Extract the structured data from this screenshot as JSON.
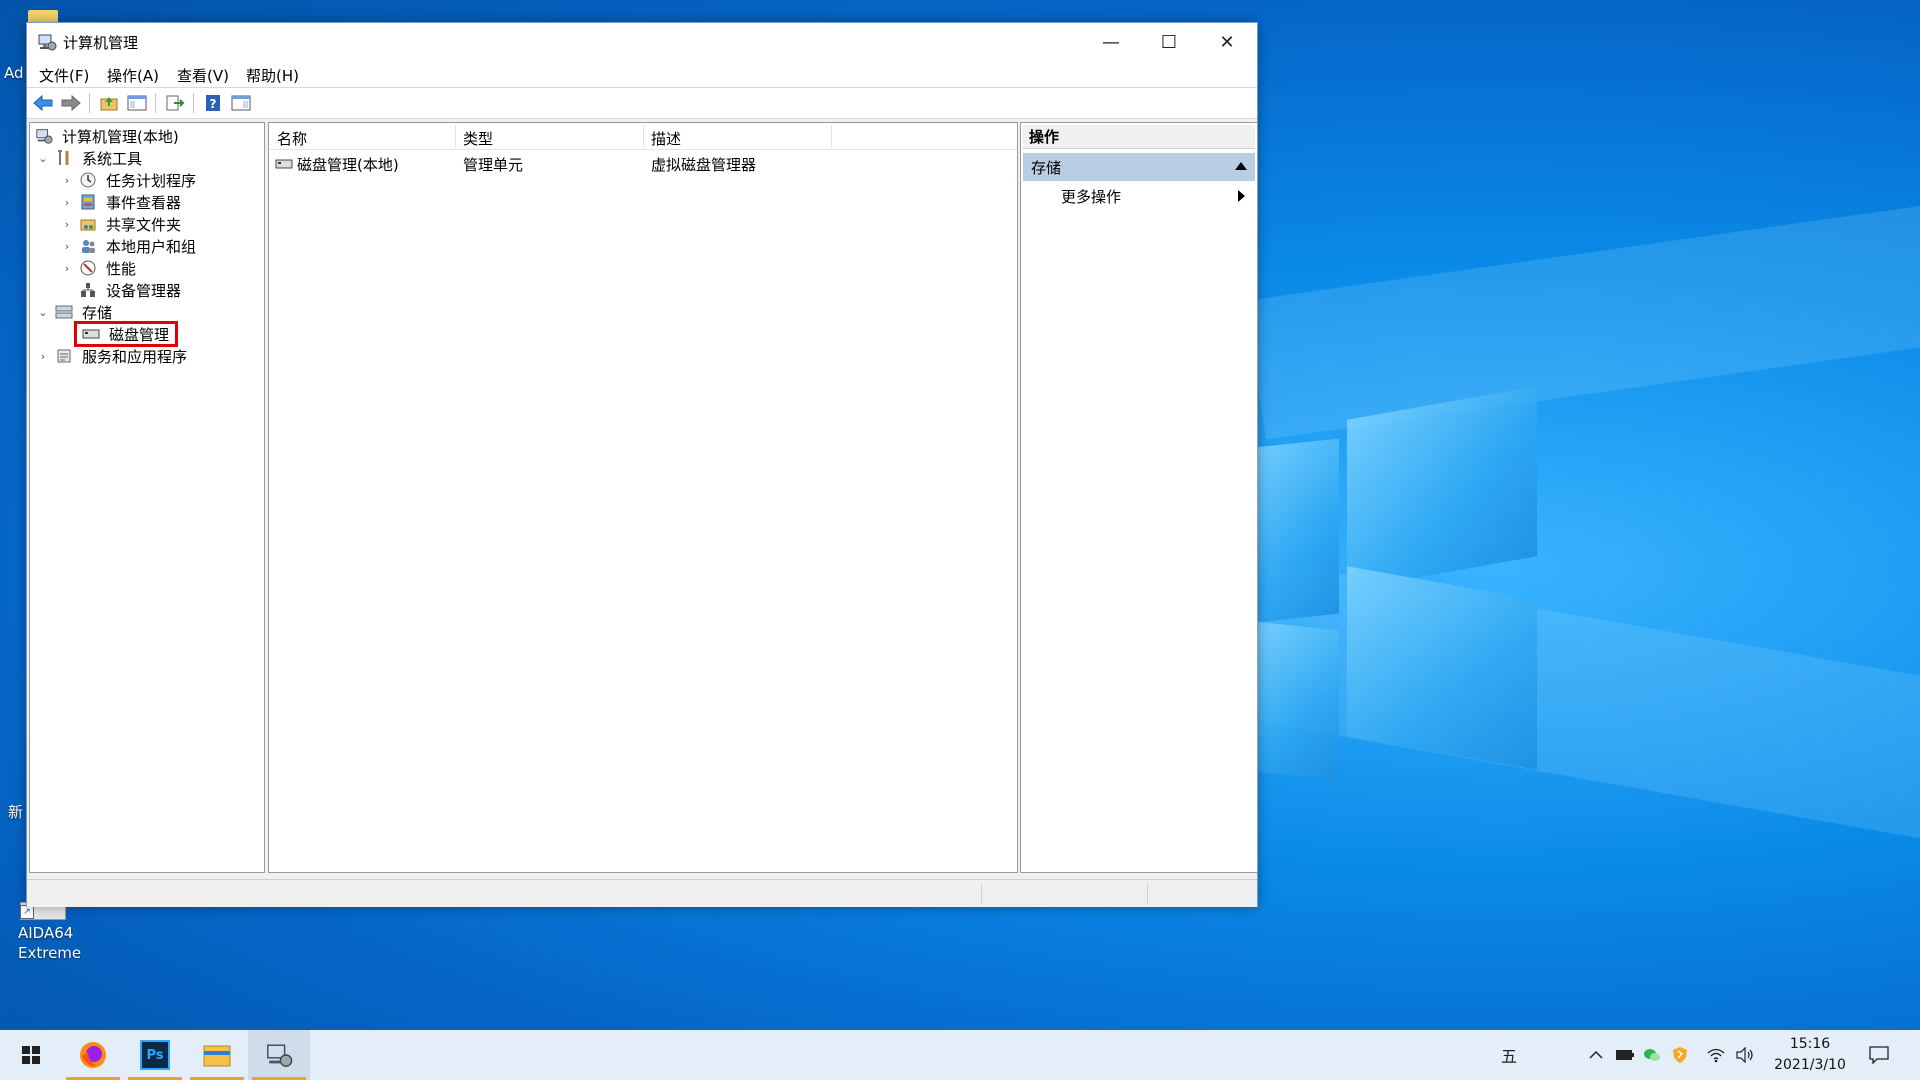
{
  "window": {
    "title": "计算机管理",
    "controls": {
      "minimize": "—",
      "maximize": "☐",
      "close": "✕"
    }
  },
  "menu": [
    "文件(F)",
    "操作(A)",
    "查看(V)",
    "帮助(H)"
  ],
  "tree": {
    "root": "计算机管理(本地)",
    "system_tools": "系统工具",
    "task_scheduler": "任务计划程序",
    "event_viewer": "事件查看器",
    "shared_folders": "共享文件夹",
    "local_users": "本地用户和组",
    "performance": "性能",
    "device_manager": "设备管理器",
    "storage": "存储",
    "disk_management": "磁盘管理",
    "services_apps": "服务和应用程序"
  },
  "list": {
    "headers": [
      "名称",
      "类型",
      "描述"
    ],
    "rows": [
      {
        "name": "磁盘管理(本地)",
        "type": "管理单元",
        "desc": "虚拟磁盘管理器"
      }
    ]
  },
  "actions": {
    "title": "操作",
    "section": "存储",
    "more": "更多操作"
  },
  "desktop": {
    "edge_text_top": "Ad",
    "edge_text_mid": "新",
    "icon_label_line1": "AIDA64",
    "icon_label_line2": "Extreme"
  },
  "taskbar": {
    "ime": "五",
    "time": "15:16",
    "date": "2021/3/10"
  },
  "colors": {
    "accent_selection": "#b9cde4",
    "highlight_box": "#e00000",
    "taskbar_bg": "#e3eef8"
  }
}
